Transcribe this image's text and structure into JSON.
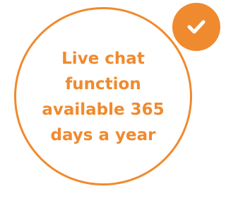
{
  "feature": {
    "text": "Live chat function available 365 days a year",
    "badge_icon": "check-icon",
    "accent_color": "#f08a2e"
  }
}
